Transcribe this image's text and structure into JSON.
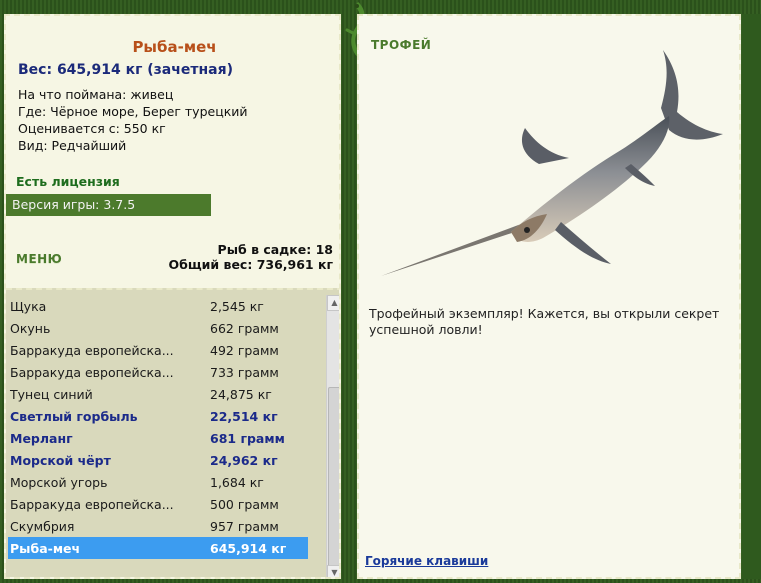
{
  "fish": {
    "name": "Рыба-меч",
    "weight_line": "Вес: 645,914 кг (зачетная)",
    "bait_line": "На что поймана: живец",
    "location_line": "Где: Чёрное море, Берег турецкий",
    "value_line": "Оценивается с: 550 кг",
    "kind_line": "Вид: Редчайший"
  },
  "license": "Есть лицензия",
  "version": "Версия игры: 3.7.5",
  "menu_label": "МЕНЮ",
  "stats": {
    "count_line": "Рыб в садке: 18",
    "total_line": "Общий вес: 736,961 кг"
  },
  "catch_list": [
    {
      "name": "Щука",
      "weight": "2,545 кг",
      "rare": false,
      "selected": false
    },
    {
      "name": "Окунь",
      "weight": "662 грамм",
      "rare": false,
      "selected": false
    },
    {
      "name": "Барракуда европейска...",
      "weight": "492 грамм",
      "rare": false,
      "selected": false
    },
    {
      "name": "Барракуда европейска...",
      "weight": "733 грамм",
      "rare": false,
      "selected": false
    },
    {
      "name": "Тунец синий",
      "weight": "24,875 кг",
      "rare": false,
      "selected": false
    },
    {
      "name": "Светлый горбыль",
      "weight": "22,514 кг",
      "rare": true,
      "selected": false
    },
    {
      "name": "Мерланг",
      "weight": "681 грамм",
      "rare": true,
      "selected": false
    },
    {
      "name": "Морской чёрт",
      "weight": "24,962 кг",
      "rare": true,
      "selected": false
    },
    {
      "name": "Морской угорь",
      "weight": "1,684 кг",
      "rare": false,
      "selected": false
    },
    {
      "name": "Барракуда европейска...",
      "weight": "500 грамм",
      "rare": false,
      "selected": false
    },
    {
      "name": "Скумбрия",
      "weight": "957 грамм",
      "rare": false,
      "selected": false
    },
    {
      "name": "Рыба-меч",
      "weight": "645,914 кг",
      "rare": false,
      "selected": true
    }
  ],
  "trophy": {
    "title": "ТРОФЕЙ",
    "text": "Трофейный экземпляр! Кажется, вы открыли секрет успешной ловли!"
  },
  "hotkeys_link": "Горячие клавиши",
  "icons": {
    "scroll_up": "scroll-up-arrow-icon",
    "scroll_down": "scroll-down-arrow-icon",
    "fish_picture": "swordfish-icon",
    "frame_ornament": "lizard-icon"
  },
  "colors": {
    "frame_green": "#2f5a1e",
    "panel_bg": "#f6f6e4",
    "list_bg": "#d9d9bc",
    "fish_name": "#b8501a",
    "rare_text": "#1b2a8a",
    "selected_row": "#3c9cf0",
    "license_green": "#1e6d1e"
  }
}
